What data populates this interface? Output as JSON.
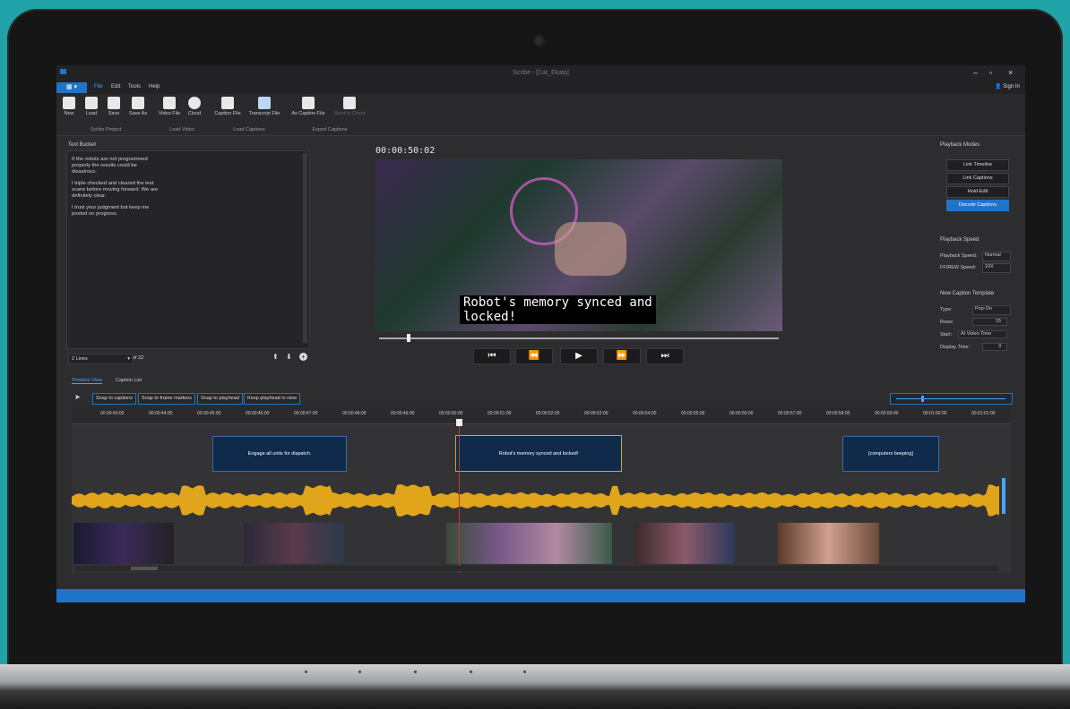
{
  "window": {
    "title": "Scribe - [Cat_Ekatp]",
    "sign_in": "Sign In"
  },
  "menu": {
    "app_button": "▦ ▾",
    "items": [
      "File",
      "Edit",
      "Tools",
      "Help"
    ]
  },
  "ribbon": {
    "buttons": [
      "New",
      "Load",
      "Save",
      "Save As",
      "Video File",
      "Cloud",
      "Caption File",
      "Transcript File",
      "As Caption File",
      "Send to Cloud"
    ],
    "groups": [
      "Scribe Project",
      "Load Video",
      "Load Captions",
      "Export Captions"
    ]
  },
  "text_bucket": {
    "label": "Text Bucket",
    "paragraphs": [
      "If the robots are not programmed properly the results could be disastrous.",
      "I triple checked and cleared the test scans before moving forward. We are definitely clear.",
      "I trust your judgment but keep me posted on progress."
    ],
    "lines_select": "2 Lines",
    "page_of": "of",
    "page_total": "22"
  },
  "video": {
    "timecode": "00:00:50:02",
    "subtitle_line1": "Robot's memory synced and",
    "subtitle_line2": "locked!",
    "progress": 0.07,
    "controls": [
      "⏮",
      "⏪",
      "▶",
      "⏩",
      "⏭"
    ]
  },
  "right_panel": {
    "playback_modes_label": "Playback Modes",
    "modes": [
      "Link Timeline",
      "Link Captions",
      "Hold-Edit",
      "Decode Captions"
    ],
    "active_mode": "Decode Captions",
    "playback_speed_label": "Playback Speed",
    "playback_speed_row": "Playback Speed:",
    "playback_speed_value": "Normal",
    "ffrew_row": "FF/REW Speed:",
    "ffrew_value": "10X",
    "template_label": "New Caption Template",
    "type_row": "Type:",
    "type_value": "Pop-On",
    "rows_row": "Rows:",
    "rows_value": "15",
    "start_row": "Start:",
    "start_value": "At Video Time",
    "display_row": "Display Time:",
    "display_value": "3"
  },
  "timeline": {
    "tabs": [
      "Timeline View",
      "Caption List"
    ],
    "toolbar": [
      "Snap to captions",
      "Snap to frame markers",
      "Snap to playhead",
      "Keep playhead in view"
    ],
    "ticks": [
      "00:00:43:00",
      "00:00:44:00",
      "00:00:45:00",
      "00:00:46:00",
      "00:00:47:00",
      "00:00:48:00",
      "00:00:49:00",
      "00:00:50:00",
      "00:00:51:00",
      "00:00:52:00",
      "00:00:53:00",
      "00:00:54:00",
      "00:00:55:00",
      "00:00:56:00",
      "00:00:57:00",
      "00:00:58:00",
      "00:00:59:00",
      "00:01:00:00",
      "00:01:01:00"
    ],
    "captions": [
      "Engage all units for dispatch.",
      "Robot's memory synced and locked!",
      "[computers beeping]"
    ]
  },
  "colors": {
    "accent": "#1f74c9",
    "waveform": "#e0a51a",
    "playhead": "#c0392b",
    "background": "#2d2d2f"
  }
}
